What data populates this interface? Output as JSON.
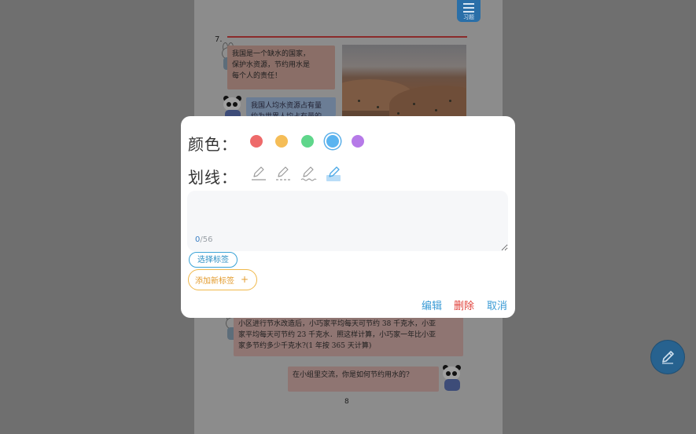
{
  "background_page": {
    "question_number": "7.",
    "exercise_button_label": "习题",
    "bubble_1": "我国是一个缺水的国家，\n保护水资源，节约用水是\n每个人的责任！",
    "bubble_2": "我国人均水资源占有量\n约为世界人均占有量的",
    "bubble_3": "小区进行节水改造后，小巧家平均每天可节约 38 千克水，小亚\n家平均每天可节约 23 千克水．照这样计算，小巧家一年比小亚\n家多节约多少千克水?(1 年按 365 天计算)",
    "bubble_4": "在小组里交流，你是如何节约用水的?",
    "page_number": "8"
  },
  "dialog": {
    "color_label": "颜色：",
    "underline_label": "划线：",
    "colors": [
      "#ee6a6a",
      "#f5bd57",
      "#5fd68b",
      "#5ab4f0",
      "#b67ae8"
    ],
    "selected_color": "#5ab4f0",
    "underline_styles": [
      "solid",
      "dashed",
      "wavy",
      "highlight"
    ],
    "selected_underline": "highlight",
    "note_value": "",
    "counter_current": "0",
    "counter_max": "/56",
    "select_tag_label": "选择标签",
    "add_tag_label": "添加新标签",
    "add_tag_plus": "+",
    "edit_label": "编辑",
    "delete_label": "删除",
    "cancel_label": "取消",
    "accent": "#3a9bd5",
    "danger": "#e0403a"
  },
  "icons": {
    "fab": "pen-icon",
    "exercise": "list-icon"
  }
}
